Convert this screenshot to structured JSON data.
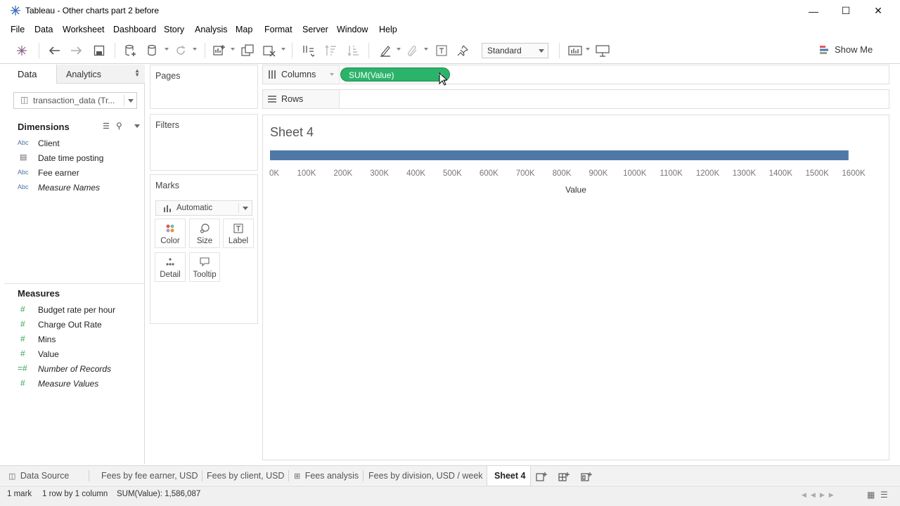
{
  "window": {
    "title": "Tableau - Other charts part 2 before"
  },
  "menu": [
    "File",
    "Data",
    "Worksheet",
    "Dashboard",
    "Story",
    "Analysis",
    "Map",
    "Format",
    "Server",
    "Window",
    "Help"
  ],
  "toolbar": {
    "fit_select": "Standard",
    "show_me": "Show Me"
  },
  "data_pane": {
    "tab_data": "Data",
    "tab_analytics": "Analytics",
    "datasource": "transaction_data (Tr...",
    "dimensions_header": "Dimensions",
    "dimensions": [
      {
        "type": "Abc",
        "label": "Client"
      },
      {
        "type": "date",
        "label": "Date time posting"
      },
      {
        "type": "Abc",
        "label": "Fee earner"
      },
      {
        "type": "Abc",
        "label": "Measure Names"
      }
    ],
    "measures_header": "Measures",
    "measures": [
      {
        "type": "#",
        "label": "Budget rate per hour"
      },
      {
        "type": "#",
        "label": "Charge Out Rate"
      },
      {
        "type": "#",
        "label": "Mins"
      },
      {
        "type": "#",
        "label": "Value"
      },
      {
        "type": "=#",
        "label": "Number of Records"
      },
      {
        "type": "#",
        "label": "Measure Values"
      }
    ]
  },
  "cards": {
    "pages": "Pages",
    "filters": "Filters",
    "marks": "Marks",
    "mark_type": "Automatic",
    "mark_buttons": [
      "Color",
      "Size",
      "Label",
      "Detail",
      "Tooltip"
    ]
  },
  "shelves": {
    "columns": "Columns",
    "rows": "Rows",
    "column_pill": "SUM(Value)"
  },
  "sheet": {
    "title": "Sheet 4"
  },
  "chart_data": {
    "type": "bar",
    "orientation": "horizontal",
    "categories": [
      ""
    ],
    "values": [
      1586087
    ],
    "xlabel": "Value",
    "xlim": [
      0,
      1600000
    ],
    "ticks": [
      "0K",
      "100K",
      "200K",
      "300K",
      "400K",
      "500K",
      "600K",
      "700K",
      "800K",
      "900K",
      "1000K",
      "1100K",
      "1200K",
      "1300K",
      "1400K",
      "1500K",
      "1600K"
    ],
    "bar_color": "#4e79a7"
  },
  "bottom_tabs": {
    "data_source": "Data Source",
    "sheets": [
      "Fees by fee earner, USD",
      "Fees by client, USD",
      "Fees analysis",
      "Fees by division, USD / week",
      "Sheet 4"
    ],
    "active": "Sheet 4"
  },
  "status": {
    "marks": "1 mark",
    "dims": "1 row by 1 column",
    "sum": "SUM(Value): 1,586,087"
  }
}
